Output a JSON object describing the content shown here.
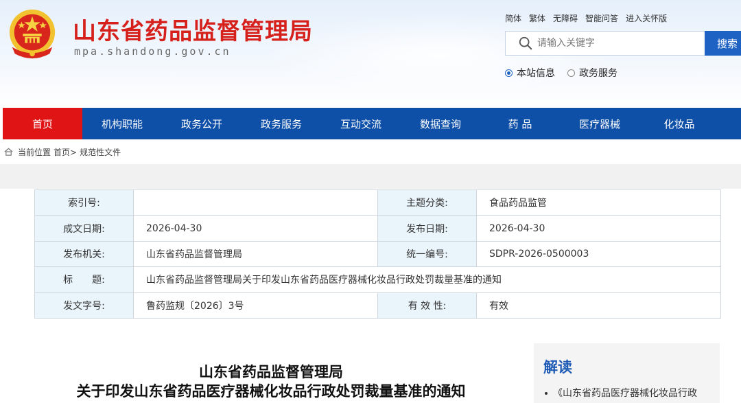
{
  "site": {
    "title": "山东省药品监督管理局",
    "domain": "mpa.shandong.gov.cn"
  },
  "top_links": [
    "简体",
    "繁体",
    "无障碍",
    "智能问答",
    "进入关怀版"
  ],
  "search": {
    "placeholder": "请输入关键字",
    "button_label": "搜索",
    "scopes": [
      {
        "label": "本站信息",
        "selected": true
      },
      {
        "label": "政务服务",
        "selected": false
      }
    ]
  },
  "nav": {
    "items": [
      "首页",
      "机构职能",
      "政务公开",
      "政务服务",
      "互动交流",
      "数据查询",
      "药 品",
      "医疗器械",
      "化妆品"
    ],
    "active_index": 0
  },
  "breadcrumb": {
    "prefix": "当前位置",
    "items": [
      "首页>",
      "规范性文件"
    ]
  },
  "meta": {
    "rows": [
      [
        {
          "label": "索引号:",
          "value": ""
        },
        {
          "label": "主题分类:",
          "value": "食品药品监管"
        }
      ],
      [
        {
          "label": "成文日期:",
          "value": "2026-04-30"
        },
        {
          "label": "发布日期:",
          "value": "2026-04-30"
        }
      ],
      [
        {
          "label": "发布机关:",
          "value": "山东省药品监督管理局"
        },
        {
          "label": "统一编号:",
          "value": "SDPR-2026-0500003"
        }
      ],
      [
        {
          "label": "标　　题:",
          "value": "山东省药品监督管理局关于印发山东省药品医疗器械化妆品行政处罚裁量基准的通知"
        }
      ],
      [
        {
          "label": "发文字号:",
          "value": "鲁药监规〔2026〕3号"
        },
        {
          "label": "有 效 性:",
          "value": "有效"
        }
      ]
    ],
    "validity_color": "#e0471c"
  },
  "article": {
    "title_line1": "山东省药品监督管理局",
    "title_line2": "关于印发山东省药品医疗器械化妆品行政处罚裁量基准的通知"
  },
  "sidebar": {
    "heading": "解读",
    "items": [
      "《山东省药品医疗器械化妆品行政"
    ]
  },
  "colors": {
    "brand_red": "#d6201b",
    "nav_blue": "#0e4fa8",
    "nav_active": "#e01414",
    "search_button": "#1e62c4",
    "side_heading": "#1e5bb5"
  }
}
